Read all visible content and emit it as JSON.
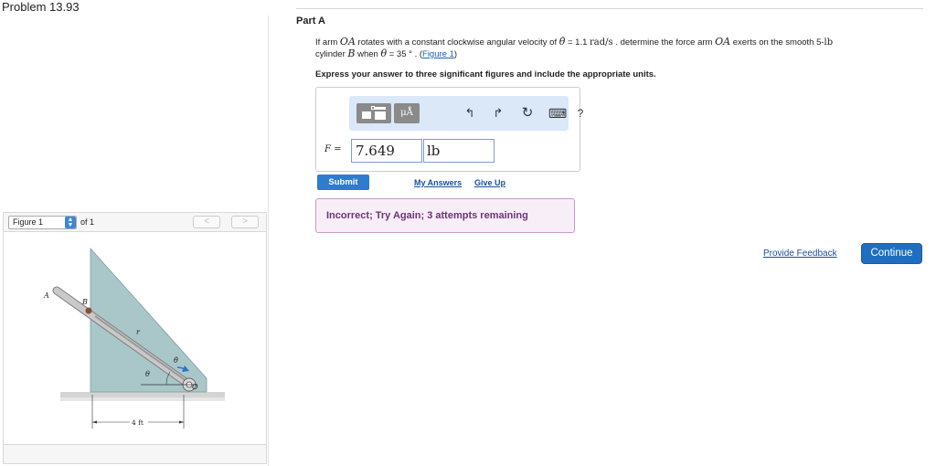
{
  "problem": {
    "title": "Problem 13.93"
  },
  "figure_nav": {
    "selected": "Figure 1",
    "of_label": "of 1",
    "prev": "<",
    "next": ">"
  },
  "figure": {
    "labels": {
      "A": "A",
      "B": "B",
      "O": "O",
      "r": "r",
      "theta": "θ",
      "theta_dot": "θ̇"
    },
    "dimension": "4 ft",
    "colors": {
      "wedge": "#a9c7c9",
      "ground": "#cfcfcf",
      "arm": "#bdbdbd",
      "arrow": "#2a74c8",
      "cylinder": "#8a4c3e"
    }
  },
  "part": {
    "title": "Part A",
    "question": {
      "t1": "If arm ",
      "OA1": "OA",
      "t2": " rotates with a constant clockwise angular velocity of ",
      "theta_dot": "θ̇",
      "t3": " = 1.1 ",
      "rate_unit": "rad/s",
      "t4": " . determine the force arm ",
      "OA2": "OA",
      "t5": " exerts on the smooth 5-",
      "lb_unit": "lb",
      "t6": "cylinder ",
      "B": "B",
      "t7": " when ",
      "theta": "θ",
      "t8": " = 35 ° . (",
      "figure_link": "Figure 1",
      "t9": ")"
    },
    "instruction": "Express your answer to three significant figures and include the appropriate units."
  },
  "answer": {
    "toolbar": {
      "units_btn": "μÅ",
      "undo_icon": "↰",
      "redo_icon": "↱",
      "reset_icon": "↻",
      "keyboard_icon": "⌨",
      "help_icon": "?"
    },
    "label_var": "F",
    "label_eq": " = ",
    "value": "7.649",
    "unit": "lb"
  },
  "actions": {
    "submit": "Submit",
    "my_answers": "My Answers",
    "give_up": "Give Up"
  },
  "feedback": {
    "message": "Incorrect; Try Again; 3 attempts remaining"
  },
  "footer": {
    "provide_feedback": "Provide Feedback",
    "continue": "Continue"
  }
}
